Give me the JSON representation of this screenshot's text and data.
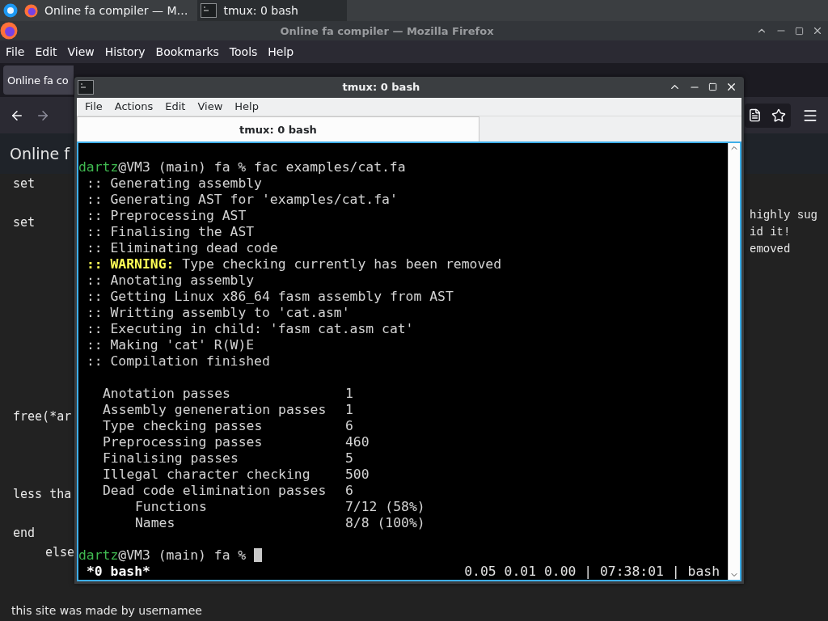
{
  "taskbar": {
    "items": [
      {
        "kind": "browser",
        "label": "Online fa compiler — M…",
        "selected": false
      },
      {
        "kind": "terminal",
        "label": "tmux: 0 bash",
        "selected": true
      }
    ]
  },
  "browser": {
    "title": "Online fa compiler — Mozilla Firefox",
    "menu": [
      "File",
      "Edit",
      "View",
      "History",
      "Bookmarks",
      "Tools",
      "Help"
    ],
    "tabs": [
      {
        "label": "Online fa co",
        "selected": true
      }
    ],
    "page": {
      "heading": "Online f",
      "code_lines": [
        {
          "text": "set",
          "indent": false
        },
        {
          "text": "set",
          "indent": false
        },
        {
          "text": "free(*ar",
          "indent": false
        },
        {
          "text": "less tha",
          "indent": false
        },
        {
          "text": "end",
          "indent": false
        },
        {
          "text": "else",
          "indent": true
        }
      ],
      "side_lines": [
        "highly sug",
        "id it!",
        "emoved"
      ],
      "footer": "this site was made by usernamee"
    }
  },
  "terminal": {
    "title": "tmux: 0 bash",
    "menu": [
      "File",
      "Actions",
      "Edit",
      "View",
      "Help"
    ],
    "tabs": [
      {
        "label": "tmux: 0 bash",
        "selected": true
      }
    ],
    "command": {
      "user": "dartz",
      "host": "@VM3 (main) fa % ",
      "text": "fac examples/cat.fa"
    },
    "log": [
      {
        "kind": "info",
        "marker": "::",
        "text": "Generating assembly"
      },
      {
        "kind": "info",
        "marker": "::",
        "text": "Generating AST for 'examples/cat.fa'"
      },
      {
        "kind": "info",
        "marker": "::",
        "text": "Preprocessing AST"
      },
      {
        "kind": "info",
        "marker": "::",
        "text": "Finalising the AST"
      },
      {
        "kind": "info",
        "marker": "::",
        "text": "Eliminating dead code"
      },
      {
        "kind": "warning",
        "marker": "::",
        "label": "WARNING:",
        "text": "Type checking currently has been removed"
      },
      {
        "kind": "info",
        "marker": "::",
        "text": "Anotating assembly"
      },
      {
        "kind": "info",
        "marker": "::",
        "text": "Getting Linux x86_64 fasm assembly from AST"
      },
      {
        "kind": "info",
        "marker": "::",
        "text": "Writting assembly to 'cat.asm'"
      },
      {
        "kind": "info",
        "marker": "::",
        "text": "Executing in child: 'fasm cat.asm cat'"
      },
      {
        "kind": "info",
        "marker": "::",
        "text": "Making 'cat' R(W)E"
      },
      {
        "kind": "info",
        "marker": "::",
        "text": "Compilation finished"
      }
    ],
    "stats": [
      {
        "label": "Anotation passes",
        "value": "1"
      },
      {
        "label": "Assembly geneneration passes",
        "value": "1"
      },
      {
        "label": "Type checking passes",
        "value": "6"
      },
      {
        "label": "Preprocessing passes",
        "value": "460"
      },
      {
        "label": "Finalising passes",
        "value": "5"
      },
      {
        "label": "Illegal character checking",
        "value": "500"
      },
      {
        "label": "Dead code elimination passes",
        "value": "6",
        "children": [
          {
            "label": "Functions",
            "value": "7/12 (58%)"
          },
          {
            "label": "Names",
            "value": "8/8 (100%)"
          }
        ]
      }
    ],
    "prompt": {
      "user": "dartz",
      "host": "@VM3 (main) fa % "
    },
    "status_bar": {
      "window": "*0 bash*",
      "info": "0.05 0.01 0.00 | 07:38:01 | bash"
    }
  }
}
